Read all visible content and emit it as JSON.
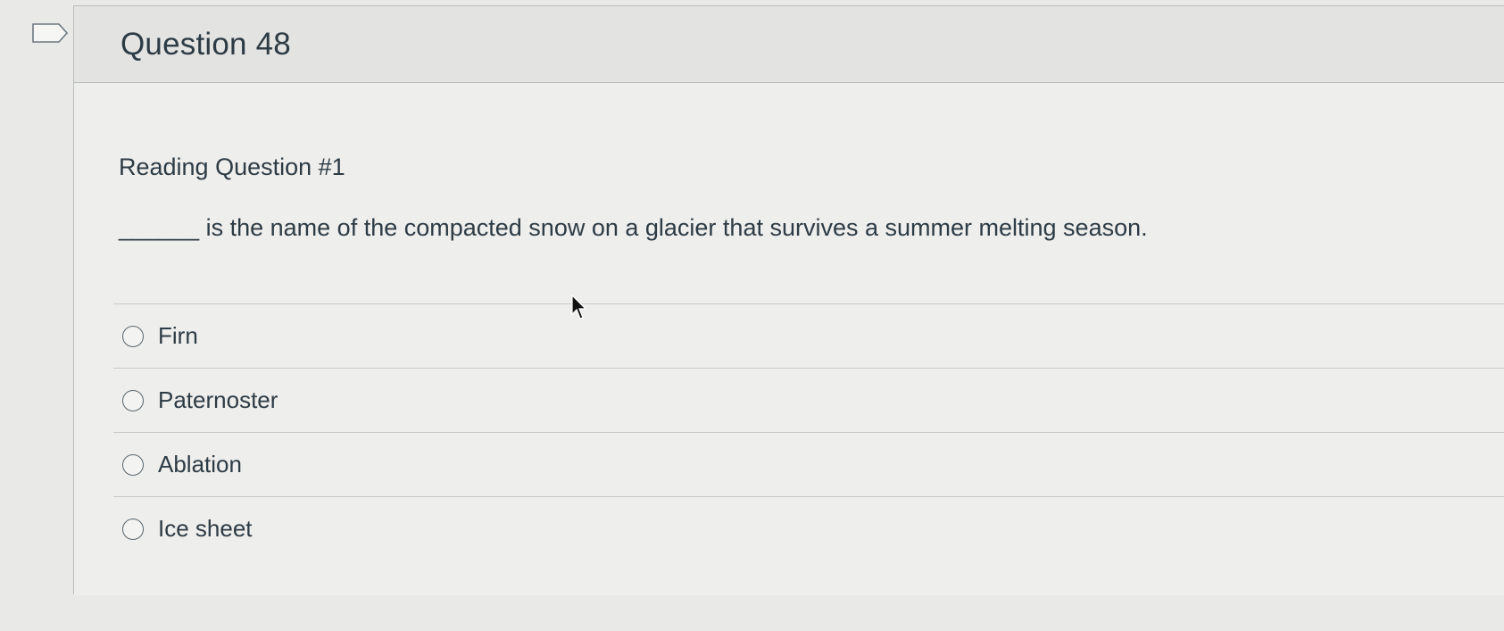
{
  "question": {
    "title": "Question 48",
    "subtitle": "Reading Question #1",
    "text": "______ is the name of the compacted snow on a glacier that survives a summer melting season.",
    "flag_icon": "flag-outline-icon"
  },
  "answers": [
    {
      "label": "Firn",
      "selected": false
    },
    {
      "label": "Paternoster",
      "selected": false
    },
    {
      "label": "Ablation",
      "selected": false
    },
    {
      "label": "Ice sheet",
      "selected": false
    }
  ],
  "colors": {
    "background": "#e9e9e7",
    "text": "#2d3b45",
    "border": "#b9bdbf"
  }
}
